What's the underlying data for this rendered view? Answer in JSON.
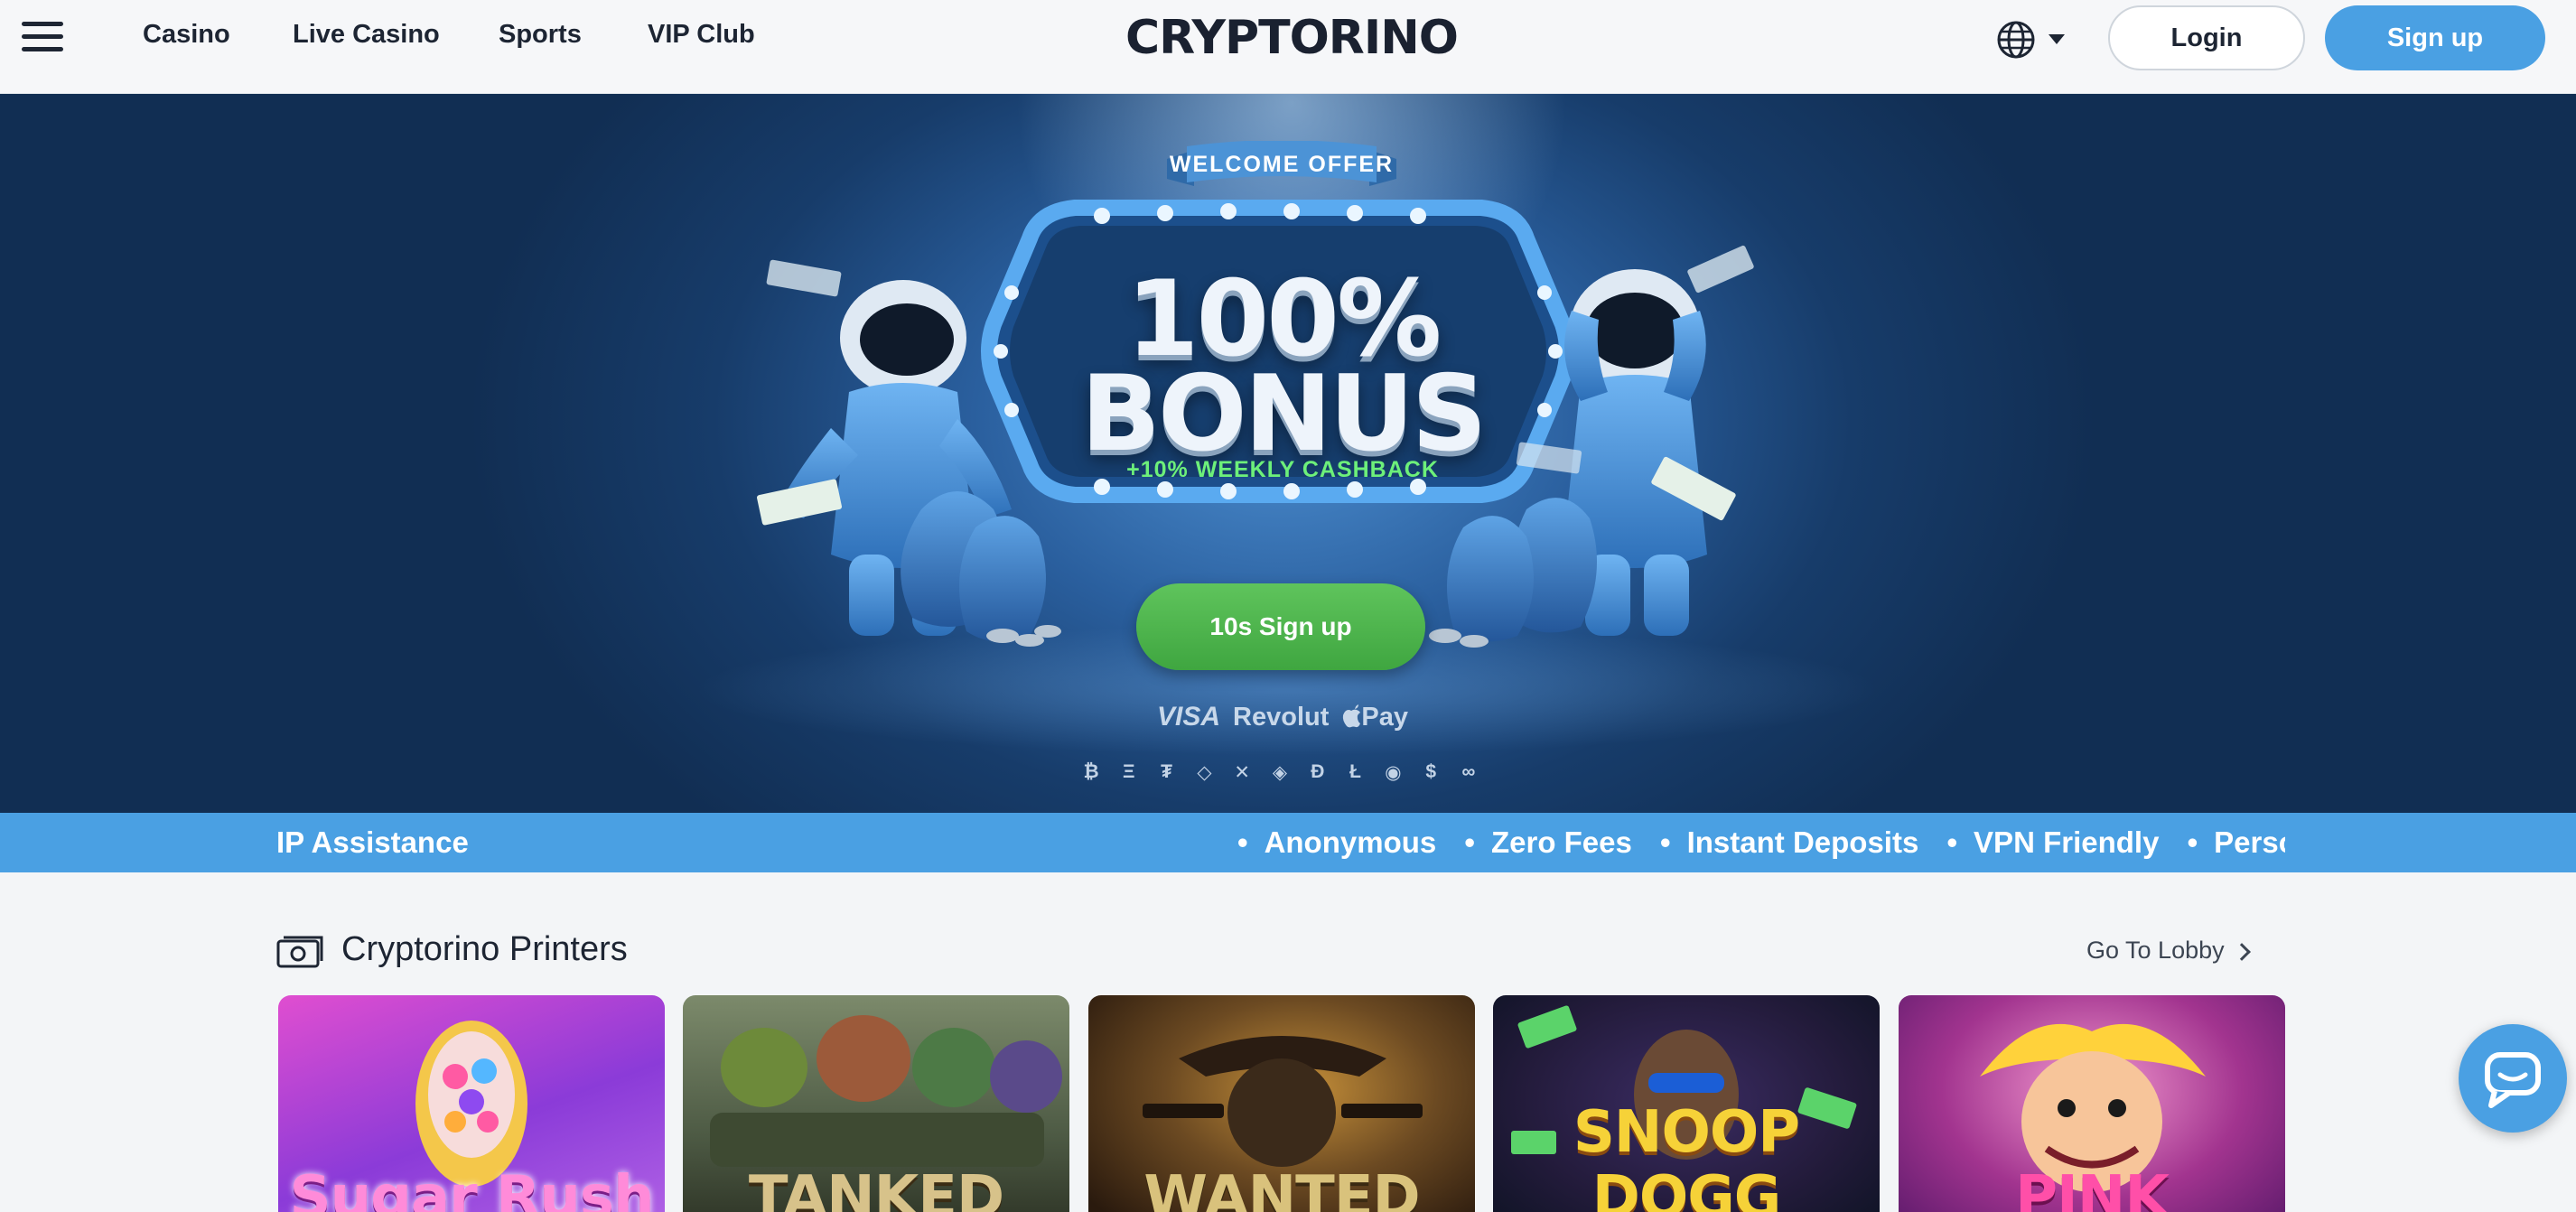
{
  "header": {
    "nav": [
      "Casino",
      "Live Casino",
      "Sports",
      "VIP Club"
    ],
    "logo": "CRYPTORINO",
    "login_label": "Login",
    "signup_label": "Sign up",
    "language_icon": "globe-icon"
  },
  "hero": {
    "ribbon": "WELCOME OFFER",
    "bonus_line1": "100%",
    "bonus_line2": "BONUS",
    "cashback": "+10% WEEKLY CASHBACK",
    "cta_label": "10s Sign up",
    "payments": {
      "visa": "VISA",
      "revolut": "Revolut",
      "applepay": "Pay"
    },
    "crypto_icons": [
      "₿",
      "Ξ",
      "₮",
      "◇",
      "✕",
      "◈",
      "Ð",
      "Ł",
      "◉",
      "$",
      "∞"
    ]
  },
  "ticker": {
    "lead": "IP Assistance",
    "items": [
      "Anonymous",
      "Zero Fees",
      "Instant Deposits",
      "VPN Friendly",
      "Personal V"
    ]
  },
  "section": {
    "title": "Cryptorino Printers",
    "lobby_label": "Go To Lobby",
    "games": [
      "Sugar Rush",
      "TANKED",
      "WANTED",
      "SNOOP DOGG",
      "PINK"
    ]
  },
  "colors": {
    "accent": "#4aa0e3",
    "cta_green": "#4fb34d",
    "hero_dark": "#112e53",
    "text": "#1d2533"
  },
  "chat_icon": "chat-bubble-icon"
}
